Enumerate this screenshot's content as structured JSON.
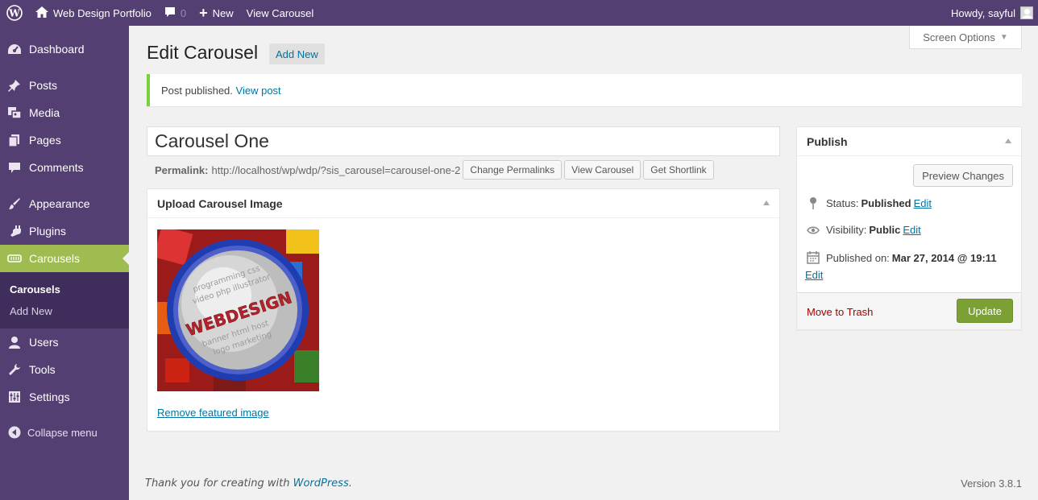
{
  "adminbar": {
    "site_name": "Web Design Portfolio",
    "comments_count": "0",
    "new_label": "New",
    "view_label": "View Carousel",
    "howdy": "Howdy, sayful"
  },
  "sidebar": {
    "items": [
      {
        "label": "Dashboard",
        "icon": "dashboard-icon"
      },
      {
        "label": "Posts",
        "icon": "pin-icon"
      },
      {
        "label": "Media",
        "icon": "media-icon"
      },
      {
        "label": "Pages",
        "icon": "pages-icon"
      },
      {
        "label": "Comments",
        "icon": "comment-icon"
      },
      {
        "label": "Appearance",
        "icon": "brush-icon"
      },
      {
        "label": "Plugins",
        "icon": "plug-icon"
      },
      {
        "label": "Carousels",
        "icon": "carousel-icon"
      },
      {
        "label": "Users",
        "icon": "user-icon"
      },
      {
        "label": "Tools",
        "icon": "wrench-icon"
      },
      {
        "label": "Settings",
        "icon": "settings-icon"
      }
    ],
    "submenu": [
      "Carousels",
      "Add New"
    ],
    "collapse_label": "Collapse menu",
    "active_color": "#9ebc4f",
    "bg_color": "#533f72"
  },
  "screen_options": "Screen Options",
  "page": {
    "title": "Edit Carousel",
    "add_new": "Add New"
  },
  "notice": {
    "text": "Post published.",
    "link": "View post"
  },
  "editor": {
    "title_value": "Carousel One",
    "permalink_label": "Permalink:",
    "permalink_url": "http://localhost/wp/wdp/?sis_carousel=carousel-one-2",
    "change_permalinks": "Change Permalinks",
    "view_carousel": "View Carousel",
    "get_shortlink": "Get Shortlink"
  },
  "carousel_box": {
    "title": "Upload Carousel Image",
    "remove_link": "Remove featured image",
    "image_text": "WEBDESIGN"
  },
  "publish": {
    "title": "Publish",
    "preview": "Preview Changes",
    "status_label": "Status:",
    "status_value": "Published",
    "visibility_label": "Visibility:",
    "visibility_value": "Public",
    "published_label": "Published on:",
    "published_value": "Mar 27, 2014 @ 19:11",
    "edit": "Edit",
    "trash": "Move to Trash",
    "update": "Update"
  },
  "footer": {
    "thanks": "Thank you for creating with",
    "wp_link": "WordPress",
    "version": "Version 3.8.1"
  }
}
